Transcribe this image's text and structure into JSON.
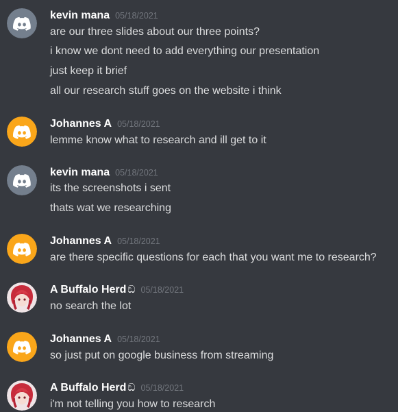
{
  "colors": {
    "background": "#36393f",
    "username": "#ffffff",
    "timestamp": "#72767d",
    "message_text": "#dcddde",
    "avatar_grey": "#747f8d",
    "avatar_yellow": "#faa61a"
  },
  "messages": [
    {
      "author": "kevin mana",
      "timestamp": "05/18/2021",
      "avatar": "discord-logo-grey",
      "lines": [
        "are our three slides about our three points?",
        "i know we dont need to add everything our presentation",
        "just keep it brief",
        "all our research stuff goes on the website i think"
      ]
    },
    {
      "author": "Johannes A",
      "timestamp": "05/18/2021",
      "avatar": "discord-logo-yellow",
      "lines": [
        "lemme know what to research and ill get to it"
      ]
    },
    {
      "author": "kevin mana",
      "timestamp": "05/18/2021",
      "avatar": "discord-logo-grey",
      "lines": [
        "its the screenshots i sent",
        "thats wat we researching"
      ]
    },
    {
      "author": "Johannes A",
      "timestamp": "05/18/2021",
      "avatar": "discord-logo-yellow",
      "lines": [
        "are there specific questions for each that you want me to research?"
      ]
    },
    {
      "author": "A Buffalo Herd",
      "badge": "ඞ",
      "timestamp": "05/18/2021",
      "avatar": "anime-character-avatar",
      "lines": [
        "no search the lot"
      ]
    },
    {
      "author": "Johannes A",
      "timestamp": "05/18/2021",
      "avatar": "discord-logo-yellow",
      "lines": [
        "so just put on google business from streaming"
      ]
    },
    {
      "author": "A Buffalo Herd",
      "badge": "ඞ",
      "timestamp": "05/18/2021",
      "avatar": "anime-character-avatar",
      "lines": [
        "i'm not telling you how to research"
      ]
    }
  ]
}
